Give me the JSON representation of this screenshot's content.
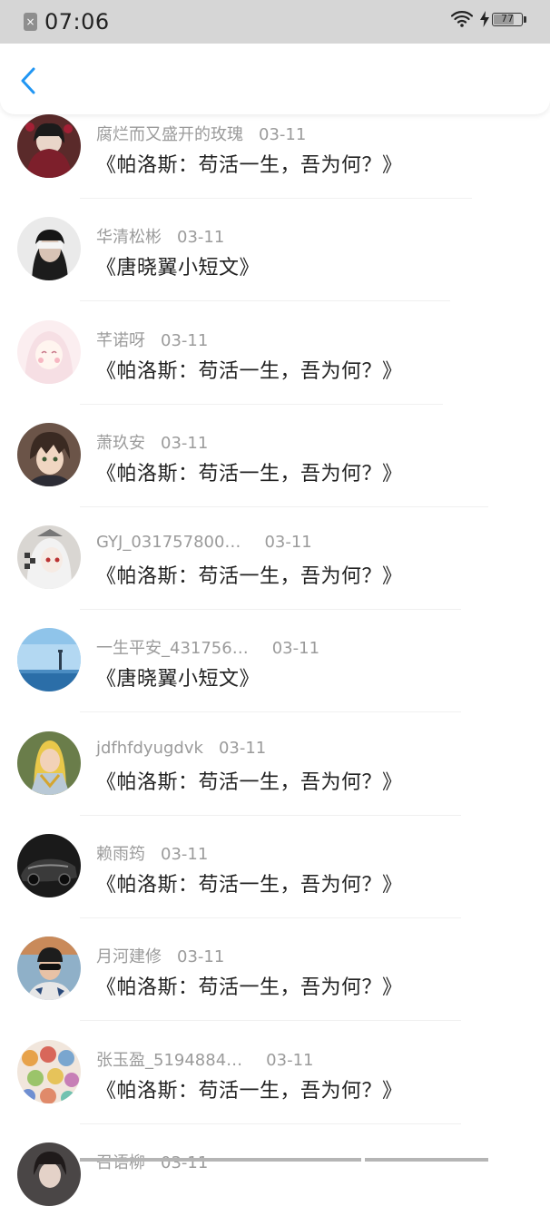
{
  "status_bar": {
    "time": "07:06",
    "battery": "77",
    "battery_level": 0.77
  },
  "header": {
    "back_icon": "chevron-left-icon",
    "accent_color": "#2196f3"
  },
  "items": [
    {
      "name": "腐烂而又盛开的玫瑰",
      "date": "03-11",
      "title": "《帕洛斯：苟活一生，吾为何？》"
    },
    {
      "name": "华清松彬",
      "date": "03-11",
      "title": "《唐晓翼小短文》"
    },
    {
      "name": "芊诺呀",
      "date": "03-11",
      "title": "《帕洛斯：苟活一生，吾为何？》"
    },
    {
      "name": "萧玖安",
      "date": "03-11",
      "title": "《帕洛斯：苟活一生，吾为何？》"
    },
    {
      "name": "GYJ_031757800…",
      "date": "03-11",
      "title": "《帕洛斯：苟活一生，吾为何？》"
    },
    {
      "name": "一生平安_431756…",
      "date": "03-11",
      "title": "《唐晓翼小短文》"
    },
    {
      "name": "jdfhfdyugdvk",
      "date": "03-11",
      "title": "《帕洛斯：苟活一生，吾为何？》"
    },
    {
      "name": "赖雨筠",
      "date": "03-11",
      "title": "《帕洛斯：苟活一生，吾为何？》"
    },
    {
      "name": "月河建修",
      "date": "03-11",
      "title": "《帕洛斯：苟活一生，吾为何？》"
    },
    {
      "name": "张玉盈_5194884…",
      "date": "03-11",
      "title": "《帕洛斯：苟活一生，吾为何？》"
    },
    {
      "name": "召语柳",
      "date": "03-11",
      "title": ""
    }
  ]
}
